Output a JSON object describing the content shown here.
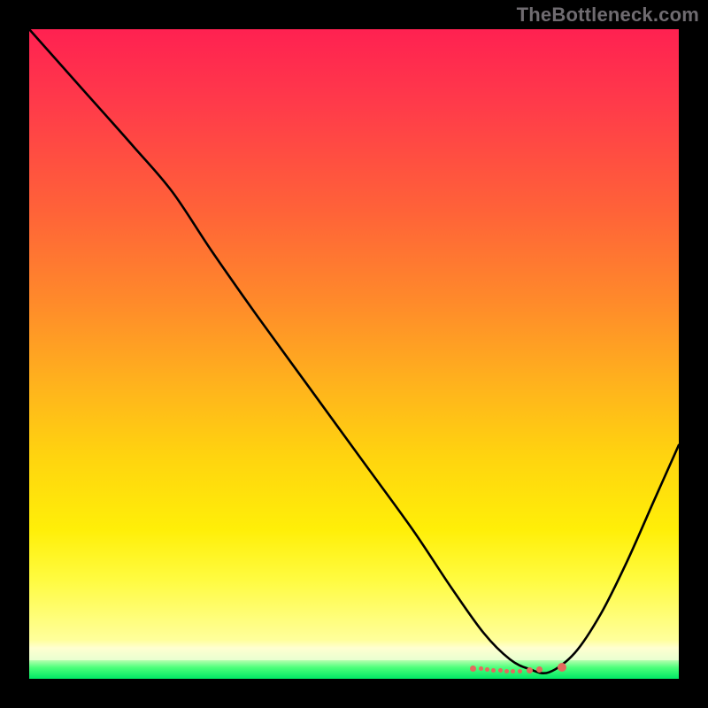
{
  "attribution": "TheBottleneck.com",
  "chart_data": {
    "type": "line",
    "title": "",
    "xlabel": "",
    "ylabel": "",
    "xlim": [
      0,
      100
    ],
    "ylim": [
      0,
      100
    ],
    "background_gradient": {
      "top": "#ff2151",
      "mid": "#ffd40f",
      "bottom_band": "#00e865"
    },
    "series": [
      {
        "name": "bottleneck-curve",
        "color": "#000000",
        "x": [
          0,
          8,
          16,
          22,
          28,
          35,
          43,
          51,
          59,
          65,
          70,
          74,
          77,
          80,
          84,
          88,
          92,
          96,
          100
        ],
        "y": [
          100,
          91,
          82,
          75,
          66,
          56,
          45,
          34,
          23,
          14,
          7,
          3,
          1.5,
          1,
          4,
          10,
          18,
          27,
          36
        ]
      }
    ],
    "markers": {
      "color": "#e36a5d",
      "points": [
        {
          "x": 68.3,
          "y": 1.6
        },
        {
          "x": 69.5,
          "y": 1.5
        },
        {
          "x": 70.5,
          "y": 1.4
        },
        {
          "x": 71.5,
          "y": 1.3
        },
        {
          "x": 72.5,
          "y": 1.25
        },
        {
          "x": 73.5,
          "y": 1.2
        },
        {
          "x": 74.5,
          "y": 1.2
        },
        {
          "x": 75.5,
          "y": 1.2
        },
        {
          "x": 77.0,
          "y": 1.3
        },
        {
          "x": 78.5,
          "y": 1.4
        },
        {
          "x": 82.0,
          "y": 1.8
        }
      ]
    }
  }
}
